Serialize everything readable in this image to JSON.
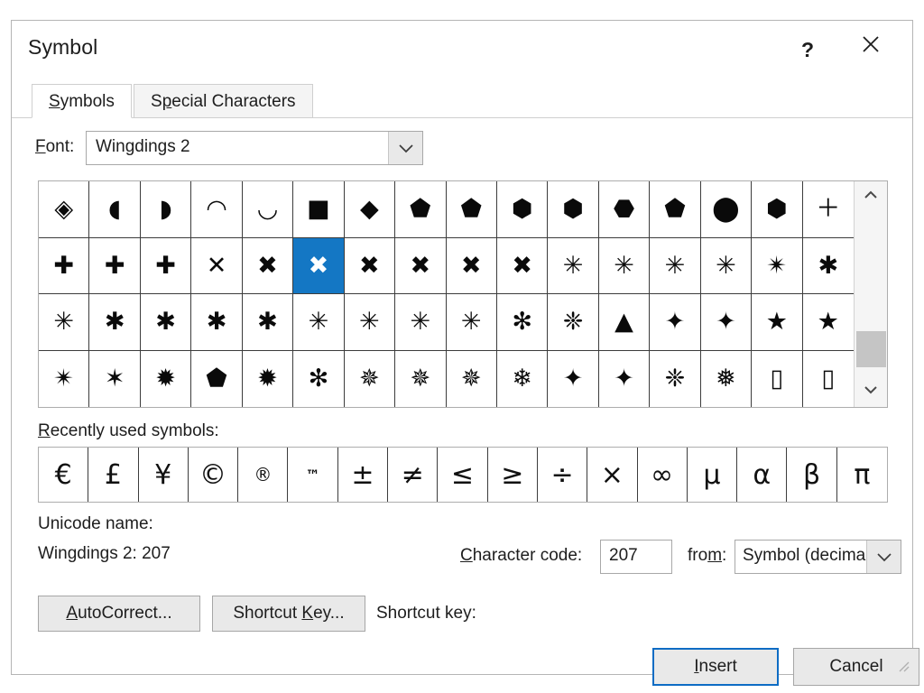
{
  "window": {
    "title": "Symbol",
    "help_icon": "question-mark-icon",
    "close_icon": "close-icon"
  },
  "tabs": [
    {
      "id": "symbols",
      "label": "Symbols",
      "accel": "S",
      "active": true
    },
    {
      "id": "special",
      "label": "Special Characters",
      "accel": "p",
      "active": false
    }
  ],
  "font": {
    "label": "Font:",
    "accel": "F",
    "value": "Wingdings 2",
    "dropdown_icon": "chevron-down-icon"
  },
  "grid": {
    "columns": 16,
    "rows": 4,
    "selected_index": 21,
    "scrollbar": {
      "up_icon": "chevron-up-icon",
      "down_icon": "chevron-down-icon"
    },
    "symbols": [
      "◈",
      "◖",
      "◗",
      "◠",
      "◡",
      "■",
      "◆",
      "⬟",
      "⬟",
      "⬢",
      "⬢",
      "⬣",
      "⬟",
      "⬤",
      "⬢",
      "＋",
      "✚",
      "✚",
      "✚",
      "✕",
      "✖",
      "✖",
      "✖",
      "✖",
      "✖",
      "✖",
      "✳",
      "✳",
      "✳",
      "✳",
      "✴",
      "✱",
      "✳",
      "✱",
      "✱",
      "✱",
      "✱",
      "✳",
      "✳",
      "✳",
      "✳",
      "✻",
      "❈",
      "▲",
      "✦",
      "✦",
      "★",
      "★",
      "✴",
      "✶",
      "✹",
      "⬟",
      "✹",
      "✻",
      "✵",
      "✵",
      "✵",
      "❄",
      "✦",
      "✦",
      "❈",
      "❅",
      "▯",
      "▯",
      "▯"
    ],
    "cell_labels": [
      "diamond-in-diamond",
      "half-circle-left",
      "half-circle-right",
      "half-disc-up",
      "half-disc-down",
      "filled-square",
      "filled-diamond",
      "pentagon-up",
      "pentagon-down",
      "hexagon-vertical",
      "hexagon-horizontal",
      "heptagon",
      "octagon",
      "filled-circle",
      "nonagon",
      "plus-thin",
      "plus-medium",
      "plus-bold",
      "plus-heavy",
      "x-thin",
      "x-light",
      "x-selected",
      "x-medium",
      "x-bold",
      "x-heavy",
      "x-extra-heavy",
      "asterisk-5-thin",
      "asterisk-5-light",
      "asterisk-5-medium",
      "asterisk-6-bold",
      "asterisk-6-heavy",
      "asterisk-8-thin",
      "asterisk-6-thin",
      "asterisk-6-light",
      "asterisk-6-medium",
      "asterisk-6-bold-2",
      "asterisk-6-heavy-2",
      "asterisk-8-light",
      "asterisk-8-medium",
      "asterisk-8-bold",
      "asterisk-8-heavy",
      "asterisk-8-extra",
      "tri-spoke",
      "triangle-spoke",
      "four-point-star-small",
      "four-point-star-filled",
      "five-point-star-thin",
      "five-point-star-filled",
      "six-point-star-thin",
      "six-point-star-filled",
      "eight-point-star-thin",
      "octagram-filled",
      "twelve-point-starburst",
      "sixteen-point-starburst",
      "tri-arrow",
      "four-point-outline-star",
      "five-point-outline-star",
      "six-point-outline-star",
      "snowflake-outline",
      "four-point-sparkle",
      "four-point-concave",
      "x-snowflake",
      "triple-snowflake",
      "empty-box-1",
      "empty-box-2",
      "empty-box-3"
    ]
  },
  "recent": {
    "label": "Recently used symbols:",
    "accel": "R",
    "symbols": [
      "€",
      "£",
      "¥",
      "©",
      "®",
      "™",
      "±",
      "≠",
      "≤",
      "≥",
      "÷",
      "×",
      "∞",
      "μ",
      "α",
      "β",
      "π"
    ],
    "names": [
      "euro-sign",
      "pound-sign",
      "yen-sign",
      "copyright-sign",
      "registered-sign",
      "trademark-sign",
      "plus-minus-sign",
      "not-equal-sign",
      "less-than-or-equal-sign",
      "greater-than-or-equal-sign",
      "division-sign",
      "multiplication-sign",
      "infinity-sign",
      "micro-sign",
      "alpha-sign",
      "beta-sign",
      "pi-sign"
    ]
  },
  "info": {
    "unicode_name_label": "Unicode name:",
    "unicode_name_value": "Wingdings 2: 207",
    "character_code_label": "Character code:",
    "character_code_accel": "C",
    "character_code_value": "207",
    "from_label": "from:",
    "from_accel": "m",
    "from_value": "Symbol (decimal)",
    "from_dropdown_icon": "chevron-down-icon"
  },
  "actions": {
    "autocorrect_label": "AutoCorrect...",
    "autocorrect_accel": "A",
    "shortcut_key_button_label": "Shortcut Key...",
    "shortcut_key_accel": "K",
    "shortcut_key_text_label": "Shortcut key:",
    "insert_label": "Insert",
    "insert_accel": "I",
    "cancel_label": "Cancel"
  },
  "colors": {
    "selection_blue": "#1477c4",
    "annotation_green": "#00e800",
    "focus_blue": "#0d6cc4",
    "dialog_bg": "#ffffff",
    "button_bg": "#e9e9e9"
  }
}
